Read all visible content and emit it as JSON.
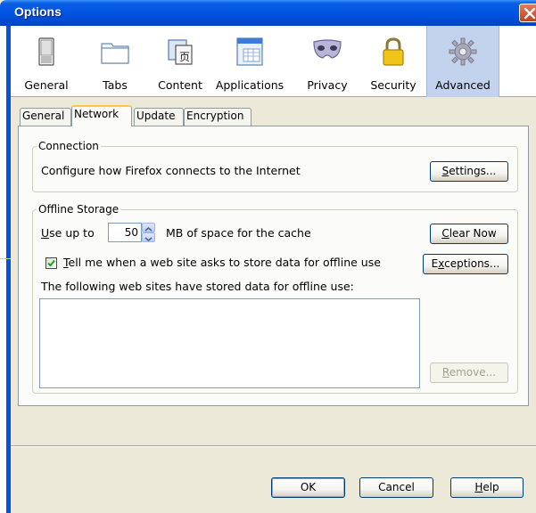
{
  "window": {
    "title": "Options"
  },
  "toolbar": {
    "panes": [
      {
        "label": "General",
        "icon": "general-switch-icon"
      },
      {
        "label": "Tabs",
        "icon": "tabs-folder-icon"
      },
      {
        "label": "Content",
        "icon": "content-page-icon"
      },
      {
        "label": "Applications",
        "icon": "applications-window-icon"
      },
      {
        "label": "Privacy",
        "icon": "privacy-mask-icon"
      },
      {
        "label": "Security",
        "icon": "security-lock-icon"
      },
      {
        "label": "Advanced",
        "icon": "advanced-gear-icon"
      }
    ],
    "selected": "Advanced"
  },
  "tabs": {
    "items": [
      {
        "label": "General"
      },
      {
        "label": "Network"
      },
      {
        "label": "Update"
      },
      {
        "label": "Encryption"
      }
    ],
    "active": "Network"
  },
  "connection": {
    "caption": "Connection",
    "description": "Configure how Firefox connects to the Internet",
    "settings_label": "ettings..."
  },
  "offline": {
    "caption": "Offline Storage",
    "use_up_to": "se up to",
    "cache_value": "50",
    "cache_suffix": "MB of space for the cache",
    "clear_now_label": "lear Now",
    "tell_me_label": "ell me when a web site asks to store data for offline use",
    "tell_me_checked": true,
    "exceptions_label_pre": "E",
    "exceptions_label_post": "ceptions...",
    "list_label": "The following web sites have stored data for offline use:",
    "sites": [],
    "remove_label": "emove..."
  },
  "footer": {
    "ok_label": "OK",
    "cancel_label": "Cancel",
    "help_label": "elp"
  },
  "colors": {
    "titlebar": "#0054e3",
    "dialog_bg": "#ece9d8",
    "selected_pane": "#c3d3ed",
    "tab_highlight": "#ffc83c"
  }
}
